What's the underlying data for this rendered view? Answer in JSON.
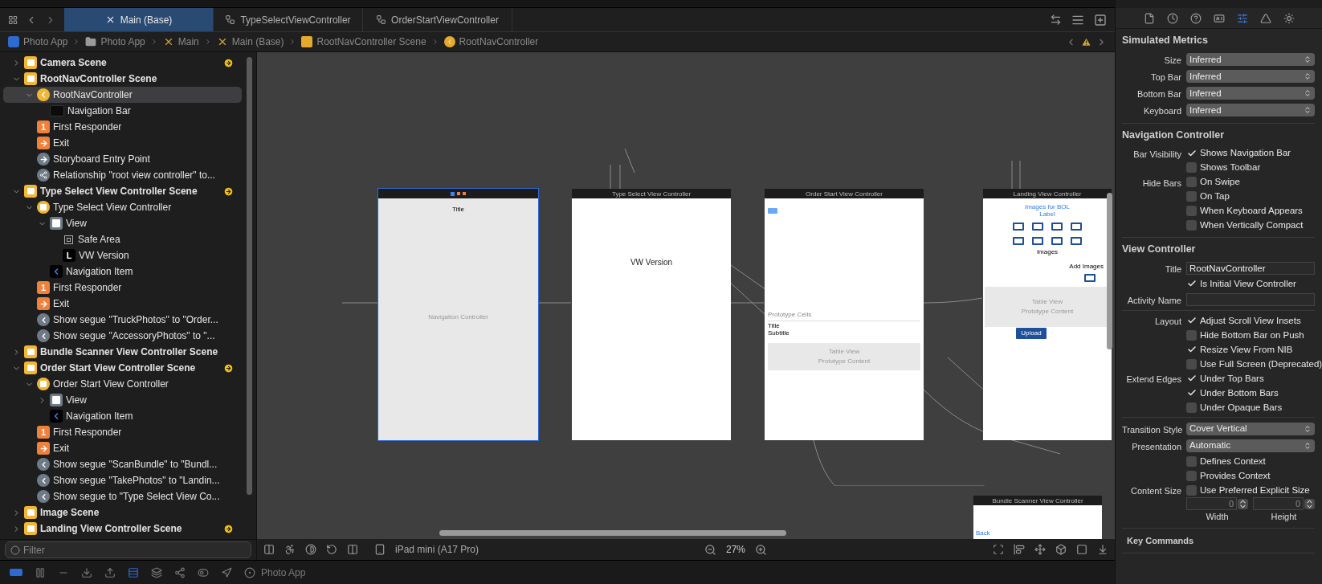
{
  "tabs": [
    {
      "label": "Main (Base)",
      "kind": "storyboard",
      "selected": true
    },
    {
      "label": "TypeSelectViewController",
      "kind": "swift",
      "selected": false
    },
    {
      "label": "OrderStartViewController",
      "kind": "swift",
      "selected": false
    }
  ],
  "breadcrumbs": [
    {
      "label": "Photo App",
      "kind": "project"
    },
    {
      "label": "Photo App",
      "kind": "folder"
    },
    {
      "label": "Main",
      "kind": "storyboard"
    },
    {
      "label": "Main (Base)",
      "kind": "storyboard"
    },
    {
      "label": "RootNavController Scene",
      "kind": "scene"
    },
    {
      "label": "RootNavController",
      "kind": "nav"
    }
  ],
  "outline": [
    {
      "label": "Camera Scene",
      "kind": "scene",
      "expanded": false,
      "entry": true
    },
    {
      "label": "RootNavController Scene",
      "kind": "scene",
      "expanded": true,
      "children": [
        {
          "label": "RootNavController",
          "kind": "nav",
          "expanded": true,
          "selected": true,
          "children": [
            {
              "label": "Navigation Bar",
              "kind": "navbar"
            }
          ]
        },
        {
          "label": "First Responder",
          "kind": "responder",
          "glyph": "1"
        },
        {
          "label": "Exit",
          "kind": "exit"
        },
        {
          "label": "Storyboard Entry Point",
          "kind": "entrypoint"
        },
        {
          "label": "Relationship \"root view controller\" to...",
          "kind": "relationship"
        }
      ]
    },
    {
      "label": "Type Select View Controller Scene",
      "kind": "scene",
      "expanded": true,
      "entry": true,
      "children": [
        {
          "label": "Type Select View Controller",
          "kind": "controller",
          "expanded": true,
          "children": [
            {
              "label": "View",
              "kind": "view",
              "expanded": true,
              "children": [
                {
                  "label": "Safe Area",
                  "kind": "safearea"
                },
                {
                  "label": "VW Version",
                  "kind": "label",
                  "glyph": "L"
                }
              ]
            },
            {
              "label": "Navigation Item",
              "kind": "navitem"
            }
          ]
        },
        {
          "label": "First Responder",
          "kind": "responder",
          "glyph": "1"
        },
        {
          "label": "Exit",
          "kind": "exit"
        },
        {
          "label": "Show segue \"TruckPhotos\" to \"Order...",
          "kind": "segue"
        },
        {
          "label": "Show segue \"AccessoryPhotos\" to \"...",
          "kind": "segue"
        }
      ]
    },
    {
      "label": "Bundle Scanner View Controller Scene",
      "kind": "scene",
      "expanded": false
    },
    {
      "label": "Order Start View Controller Scene",
      "kind": "scene",
      "expanded": true,
      "entry": true,
      "children": [
        {
          "label": "Order Start View Controller",
          "kind": "controller",
          "expanded": true,
          "children": [
            {
              "label": "View",
              "kind": "view",
              "expanded": false
            },
            {
              "label": "Navigation Item",
              "kind": "navitem"
            }
          ]
        },
        {
          "label": "First Responder",
          "kind": "responder",
          "glyph": "1"
        },
        {
          "label": "Exit",
          "kind": "exit"
        },
        {
          "label": "Show segue \"ScanBundle\" to \"Bundl...",
          "kind": "segue"
        },
        {
          "label": "Show segue \"TakePhotos\" to \"Landin...",
          "kind": "segue"
        },
        {
          "label": "Show segue to \"Type Select View Co...",
          "kind": "segue"
        }
      ]
    },
    {
      "label": "Image Scene",
      "kind": "scene",
      "expanded": false
    },
    {
      "label": "Landing View Controller Scene",
      "kind": "scene",
      "expanded": false,
      "entry": true
    }
  ],
  "filter": {
    "placeholder": "Filter"
  },
  "scenes": [
    {
      "kind": "nav",
      "selected": true,
      "title": "Title",
      "center": "Navigation Controller"
    },
    {
      "kind": "typeselect",
      "selected": false,
      "header": "Type Select View Controller",
      "label": "VW Version"
    },
    {
      "kind": "orderstart",
      "selected": false,
      "header": "Order Start View Controller",
      "cells": "Prototype Cells",
      "cell_title": "Title",
      "cell_subtitle": "Subtitle",
      "table": "Table View",
      "table_sub": "Prototype Content"
    },
    {
      "kind": "landing",
      "selected": false,
      "header": "Landing View Controller",
      "heading": "Images for BOL",
      "label": "Label",
      "images": "Images",
      "add": "Add Images",
      "table": "Table View",
      "table_sub": "Prototype Content",
      "upload": "Upload"
    },
    {
      "kind": "bundle",
      "selected": false,
      "header": "Bundle Scanner View Controller",
      "back": "Back"
    }
  ],
  "canvas_bar": {
    "device": "iPad mini (A17 Pro)",
    "zoom": "27%"
  },
  "debug_bar": {
    "breakpoints_active": true,
    "scheme": "Photo App"
  },
  "inspector": {
    "sections": [
      {
        "title": "Simulated Metrics",
        "groups": [
          [
            {
              "kind": "popup",
              "label": "Size",
              "value": "Inferred"
            },
            {
              "kind": "popup",
              "label": "Top Bar",
              "value": "Inferred"
            },
            {
              "kind": "popup",
              "label": "Bottom Bar",
              "value": "Inferred"
            },
            {
              "kind": "popup",
              "label": "Keyboard",
              "value": "Inferred"
            }
          ]
        ]
      },
      {
        "title": "Navigation Controller",
        "groups": [
          [
            {
              "kind": "check",
              "label": "Bar Visibility",
              "text": "Shows Navigation Bar",
              "checked": true
            },
            {
              "kind": "check",
              "text": "Shows Toolbar",
              "checked": false
            },
            {
              "kind": "check",
              "label": "Hide Bars",
              "text": "On Swipe",
              "checked": false
            },
            {
              "kind": "check",
              "text": "On Tap",
              "checked": false
            },
            {
              "kind": "check",
              "text": "When Keyboard Appears",
              "checked": false
            },
            {
              "kind": "check",
              "text": "When Vertically Compact",
              "checked": false
            }
          ]
        ]
      },
      {
        "title": "View Controller",
        "groups": [
          [
            {
              "kind": "field",
              "label": "Title",
              "value": "RootNavController"
            },
            {
              "kind": "check",
              "text": "Is Initial View Controller",
              "checked": true
            },
            {
              "kind": "field",
              "label": "Activity Name"
            }
          ],
          [
            {
              "kind": "check",
              "label": "Layout",
              "text": "Adjust Scroll View Insets",
              "checked": true
            },
            {
              "kind": "check",
              "text": "Hide Bottom Bar on Push",
              "checked": false
            },
            {
              "kind": "check",
              "text": "Resize View From NIB",
              "checked": true
            },
            {
              "kind": "check",
              "text": "Use Full Screen (Deprecated)",
              "checked": false
            },
            {
              "kind": "check",
              "label": "Extend Edges",
              "text": "Under Top Bars",
              "checked": true
            },
            {
              "kind": "check",
              "text": "Under Bottom Bars",
              "checked": true
            },
            {
              "kind": "check",
              "text": "Under Opaque Bars",
              "checked": false
            }
          ],
          [
            {
              "kind": "popup",
              "label": "Transition Style",
              "value": "Cover Vertical"
            },
            {
              "kind": "popup",
              "label": "Presentation",
              "value": "Automatic"
            },
            {
              "kind": "check",
              "text": "Defines Context",
              "checked": false
            },
            {
              "kind": "check",
              "text": "Provides Context",
              "checked": false
            },
            {
              "kind": "check",
              "label": "Content Size",
              "text": "Use Preferred Explicit Size",
              "checked": false
            },
            {
              "kind": "steppers",
              "fields": [
                {
                  "placeholder": "0",
                  "caption": "Width"
                },
                {
                  "placeholder": "0",
                  "caption": "Height"
                }
              ]
            }
          ]
        ]
      },
      {
        "title": "Key Commands"
      }
    ]
  }
}
